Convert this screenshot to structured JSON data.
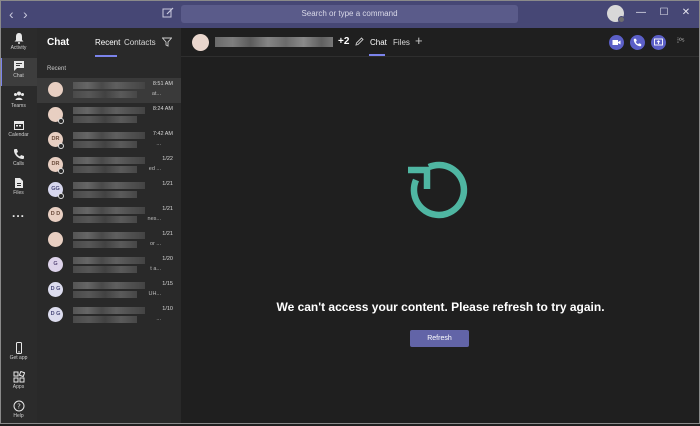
{
  "titlebar": {
    "search_placeholder": "Search or type a command"
  },
  "rail": [
    {
      "label": "Activity",
      "icon": "bell-icon"
    },
    {
      "label": "Chat",
      "icon": "chat-icon",
      "active": true
    },
    {
      "label": "Teams",
      "icon": "teams-icon"
    },
    {
      "label": "Calendar",
      "icon": "calendar-icon"
    },
    {
      "label": "Calls",
      "icon": "phone-icon"
    },
    {
      "label": "Files",
      "icon": "files-icon"
    },
    {
      "label": "...",
      "icon": "more-icon"
    },
    {
      "label": "Get app",
      "icon": "mobile-icon"
    },
    {
      "label": "Apps",
      "icon": "apps-icon"
    },
    {
      "label": "Help",
      "icon": "help-icon"
    }
  ],
  "chat_panel": {
    "title": "Chat",
    "tabs": [
      "Recent",
      "Contacts"
    ],
    "section": "Recent",
    "rows": [
      {
        "initials": "",
        "time": "8:51 AM",
        "snippet": "at..."
      },
      {
        "initials": "",
        "time": "8:24 AM",
        "snippet": ""
      },
      {
        "initials": "DR",
        "time": "7:42 AM",
        "snippet": "..."
      },
      {
        "initials": "DR",
        "time": "1/22",
        "snippet": "ed ..."
      },
      {
        "initials": "GG",
        "time": "1/21",
        "snippet": ""
      },
      {
        "initials": "D D",
        "time": "1/21",
        "snippet": "nes..."
      },
      {
        "initials": "",
        "time": "1/21",
        "snippet": "or ..."
      },
      {
        "initials": "G",
        "time": "1/20",
        "snippet": "t a..."
      },
      {
        "initials": "D G",
        "time": "1/15",
        "snippet": "UH..."
      },
      {
        "initials": "D G",
        "time": "1/10",
        "snippet": "..."
      }
    ]
  },
  "header": {
    "extra_count": "+2",
    "tabs": [
      "Chat",
      "Files"
    ],
    "add": "+",
    "more": "⁞⁰⁵"
  },
  "content": {
    "message": "We can't access your content. Please refresh to try again.",
    "refresh_label": "Refresh",
    "accent": "#4fb6a2"
  },
  "colors": {
    "titlebar": "#464775",
    "brand": "#6264a7",
    "accent": "#7b83eb"
  }
}
